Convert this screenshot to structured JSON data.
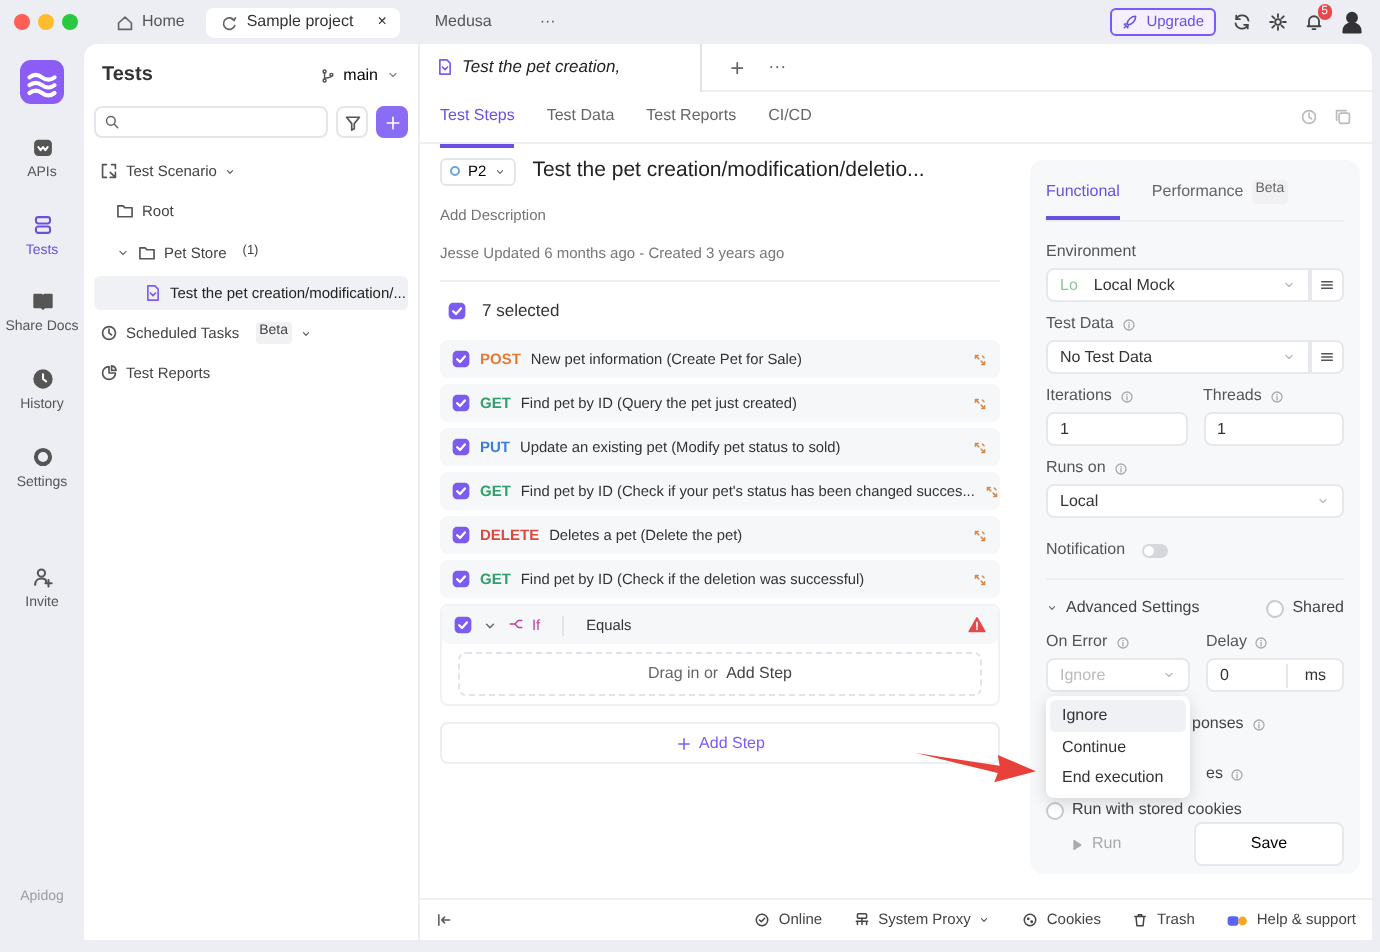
{
  "top_tabs": [
    {
      "label": "Home",
      "selected": false
    },
    {
      "label": "Sample project",
      "selected": true,
      "close": "×"
    },
    {
      "label": "Medusa",
      "selected": false
    },
    {
      "label": "···",
      "selected": false
    }
  ],
  "upgrade_button": "Upgrade",
  "notification_count": "5",
  "rail": {
    "items": [
      {
        "label": "APIs",
        "selected": false
      },
      {
        "label": "Tests",
        "selected": true
      },
      {
        "label": "Share Docs",
        "selected": false
      },
      {
        "label": "History",
        "selected": false
      },
      {
        "label": "Settings",
        "selected": false
      },
      {
        "label": "Invite",
        "selected": false
      }
    ],
    "brand": "Apidog"
  },
  "sidebar": {
    "title": "Tests",
    "branch": "main",
    "tree": [
      {
        "kind": "scenario",
        "label": "Test Scenario",
        "dropdown": true,
        "selected": false,
        "children": [
          {
            "kind": "folder",
            "label": "Root",
            "selected": false
          },
          {
            "kind": "folder",
            "label": "Pet Store",
            "count": "(1)",
            "expanded": true,
            "selected": false,
            "children": [
              {
                "kind": "test",
                "label": "Test the pet creation/modification/...",
                "selected": true
              }
            ]
          }
        ]
      },
      {
        "kind": "schedule",
        "label": "Scheduled Tasks",
        "badge": "Beta",
        "dropdown": true,
        "selected": false
      },
      {
        "kind": "reports",
        "label": "Test Reports",
        "selected": false
      }
    ]
  },
  "doc_tab": {
    "title": "Test the pet creation,",
    "new_tab": "+",
    "more": "···"
  },
  "subtabs": [
    {
      "label": "Test Steps",
      "selected": true
    },
    {
      "label": "Test Data",
      "selected": false
    },
    {
      "label": "Test Reports",
      "selected": false
    },
    {
      "label": "CI/CD",
      "selected": false
    }
  ],
  "scenario": {
    "priority": "P2",
    "title": "Test the pet creation/modification/deletio...",
    "description_placeholder": "Add Description",
    "meta": "Jesse Updated 6 months ago - Created 3 years ago"
  },
  "selection": {
    "label": "7 selected",
    "checked": true
  },
  "steps": [
    {
      "kind": "request",
      "method": "POST",
      "color": "#e07b39",
      "name": "New pet information (Create Pet for Sale)",
      "checked": true
    },
    {
      "kind": "request",
      "method": "GET",
      "color": "#2f9e6a",
      "name": "Find pet by ID (Query the pet just created)",
      "checked": true
    },
    {
      "kind": "request",
      "method": "PUT",
      "color": "#3c7dd9",
      "name": "Update an existing pet (Modify pet status to sold)",
      "checked": true
    },
    {
      "kind": "request",
      "method": "GET",
      "color": "#2f9e6a",
      "name": "Find pet by ID (Check if your pet's status has been changed succes...",
      "checked": true
    },
    {
      "kind": "request",
      "method": "DELETE",
      "color": "#d9493f",
      "name": "Deletes a pet (Delete the pet)",
      "checked": true
    },
    {
      "kind": "request",
      "method": "GET",
      "color": "#2f9e6a",
      "name": "Find pet by ID (Check if the deletion was successful)",
      "checked": true
    },
    {
      "kind": "if",
      "keyword": "If",
      "condition": "Equals",
      "checked": true,
      "expanded": true,
      "warning": true,
      "drop_text": "Drag in or",
      "drop_link": "Add Step"
    }
  ],
  "add_step": "Add Step",
  "settings": {
    "tabs": [
      {
        "label": "Functional",
        "selected": true
      },
      {
        "label": "Performance",
        "badge": "Beta",
        "selected": false
      }
    ],
    "fields": [
      {
        "kind": "select",
        "label": "Environment",
        "prefix": "Lo",
        "value": "Local Mock",
        "menu": true
      },
      {
        "kind": "select",
        "label": "Test Data",
        "info": true,
        "value": "No Test Data",
        "menu": true
      },
      {
        "kind": "pair",
        "items": [
          {
            "label": "Iterations",
            "info": true,
            "value": "1"
          },
          {
            "label": "Threads",
            "info": true,
            "value": "1"
          }
        ]
      },
      {
        "kind": "select",
        "label": "Runs on",
        "info": true,
        "value": "Local"
      },
      {
        "kind": "toggle",
        "label": "Notification",
        "on": false
      }
    ],
    "advanced": {
      "label": "Advanced Settings",
      "expanded": true,
      "shared": {
        "label": "Shared",
        "checked": false
      },
      "on_error": {
        "label": "On Error",
        "info": true,
        "placeholder": "Ignore"
      },
      "delay": {
        "label": "Delay",
        "info": true,
        "value": "0",
        "unit": "ms"
      },
      "partial_rows": [
        {
          "text": "ponses",
          "info": true
        },
        {
          "text": "es",
          "info": true
        }
      ],
      "cookies": {
        "label": "Run with stored cookies",
        "checked": false
      },
      "menu": [
        {
          "label": "Ignore",
          "selected": true
        },
        {
          "label": "Continue",
          "selected": false
        },
        {
          "label": "End execution",
          "selected": false
        }
      ]
    },
    "run_button": {
      "label": "Run",
      "disabled": true
    },
    "save_button": "Save"
  },
  "status_bar": [
    {
      "kind": "online",
      "label": "Online"
    },
    {
      "kind": "proxy",
      "label": "System Proxy",
      "dropdown": true
    },
    {
      "kind": "cookies",
      "label": "Cookies"
    },
    {
      "kind": "trash",
      "label": "Trash"
    },
    {
      "kind": "help",
      "label": "Help & support"
    }
  ]
}
